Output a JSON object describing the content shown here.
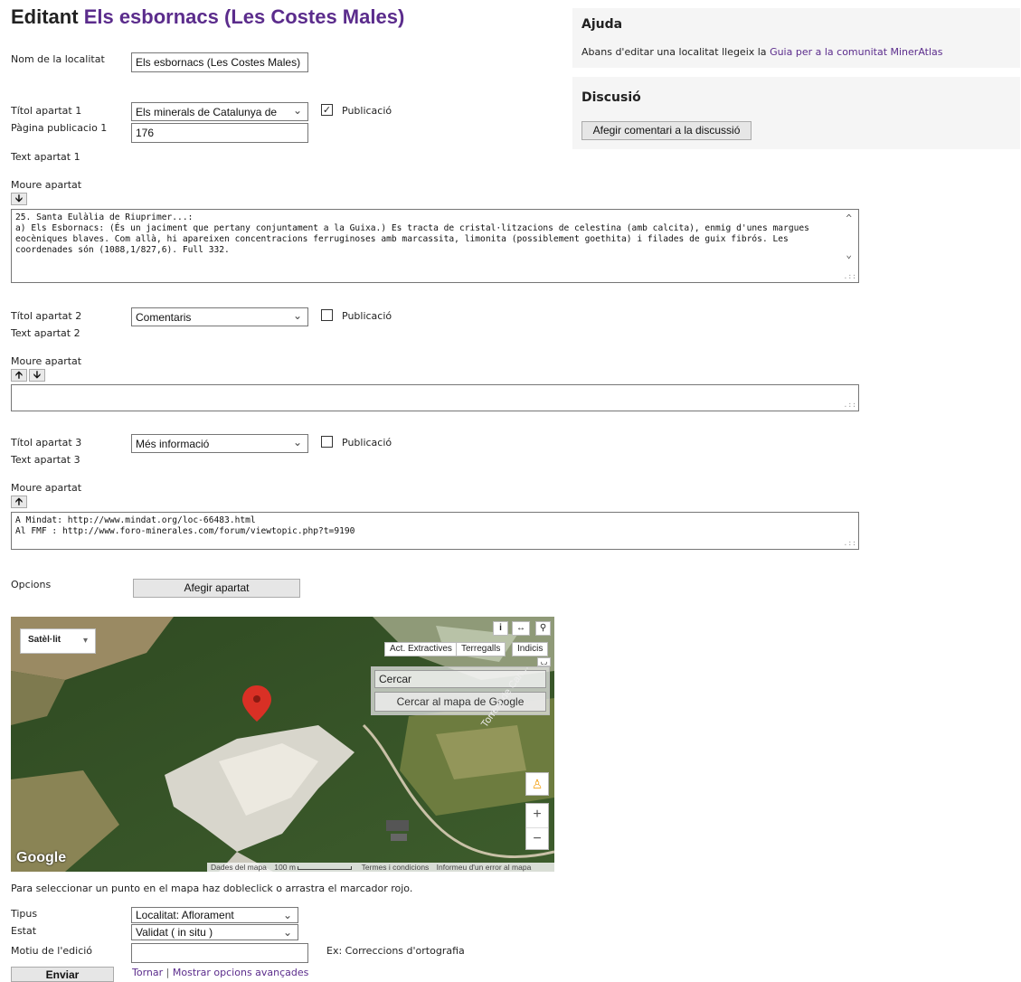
{
  "page": {
    "title_prefix": "Editant",
    "title_location": "Els esbornacs (Les Costes Males)"
  },
  "form": {
    "name_label": "Nom de la localitat",
    "name_value": "Els esbornacs (Les Costes Males)",
    "sections": [
      {
        "title_label": "Títol apartat 1",
        "title_value": "Els minerals de Catalunya de",
        "publication_label": "Publicació",
        "publication_checked": true,
        "page_label": "Pàgina publicacio 1",
        "page_value": "176",
        "text_label": "Text apartat 1",
        "move_label": "Moure apartat",
        "text_value": "25. Santa Eulàlia de Riuprimer...:\na) Els Esbornacs: (És un jaciment que pertany conjuntament a la Guixa.) Es tracta de cristal·litzacions de celestina (amb calcita), enmig d'unes margues eocèniques blaves. Com allà, hi apareixen concentracions ferruginoses amb marcassita, limonita (possiblement goethita) i filades de guix fibrós. Les coordenades són (1088,1/827,6). Full 332."
      },
      {
        "title_label": "Títol apartat 2",
        "title_value": "Comentaris",
        "publication_label": "Publicació",
        "publication_checked": false,
        "text_label": "Text apartat 2",
        "move_label": "Moure apartat",
        "text_value": ""
      },
      {
        "title_label": "Títol apartat 3",
        "title_value": "Més informació",
        "publication_label": "Publicació",
        "publication_checked": false,
        "text_label": "Text apartat 3",
        "move_label": "Moure apartat",
        "text_value": "A Mindat: http://www.mindat.org/loc-66483.html\nAl FMF : http://www.foro-minerales.com/forum/viewtopic.php?t=9190"
      }
    ],
    "options_label": "Opcions",
    "add_section_label": "Afegir apartat",
    "map_hint": "Para seleccionar un punto en el mapa haz dobleclick o arrastra el marcador rojo.",
    "type_label": "Tipus",
    "type_value": "Localitat: Aflorament",
    "state_label": "Estat",
    "state_value": "Validat ( in situ )",
    "reason_label": "Motiu de l'edició",
    "reason_value": "",
    "reason_example": "Ex: Correccions d'ortografia",
    "submit_label": "Enviar",
    "back_label": "Tornar",
    "separator": "|",
    "advanced_label": "Mostrar opcions avançades"
  },
  "map": {
    "map_type": "Satèl·lit",
    "layers": [
      "Act. Extractives",
      "Terregalls",
      "Indicis"
    ],
    "search_placeholder": "Cercar",
    "search_button": "Cercar al mapa de Google",
    "road_label": "Torrent de Can...",
    "logo": "Google",
    "footer": {
      "data": "Dades del mapa",
      "scale": "100 m",
      "terms": "Termes i condicions",
      "report": "Informeu d'un error al mapa"
    },
    "zoom_in": "+",
    "zoom_out": "−"
  },
  "sidebar": {
    "help_title": "Ajuda",
    "help_text_prefix": "Abans d'editar una localitat llegeix la ",
    "help_link": "Guia per a la comunitat MinerAtlas",
    "discussion_title": "Discusió",
    "add_comment_label": "Afegir comentari a la discussió"
  },
  "colors": {
    "title_accent": "#5b2c8c",
    "link": "#5b2c8c",
    "marker": "#d93025"
  }
}
